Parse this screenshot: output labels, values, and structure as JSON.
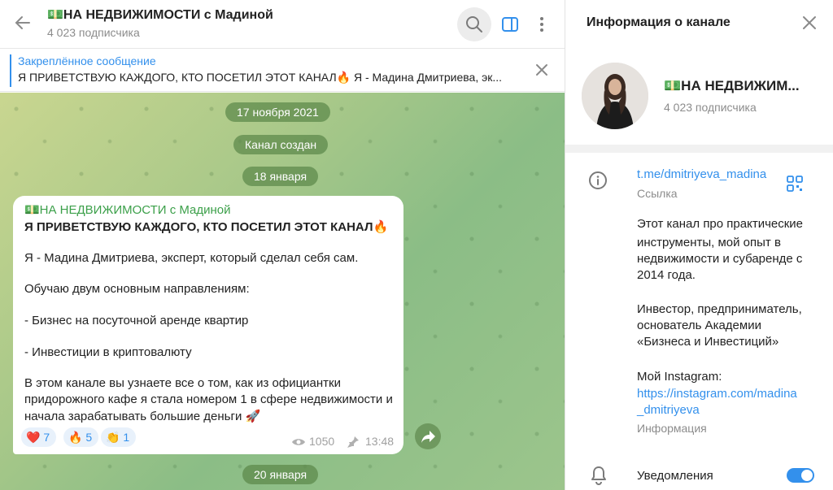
{
  "channel": {
    "title": "💵НА НЕДВИЖИМОСТИ с Мадиной",
    "subscribers": "4 023 подписчика"
  },
  "pinned": {
    "title": "Закреплённое сообщение",
    "text": "Я ПРИВЕТСТВУЮ КАЖДОГО, КТО ПОСЕТИЛ ЭТОТ КАНАЛ🔥  Я - Мадина Дмитриева, эк..."
  },
  "dates": {
    "d1": "17 ноября 2021",
    "created": "Канал создан",
    "d2": "18 января",
    "d3": "20 января"
  },
  "message": {
    "author": "💵НА НЕДВИЖИМОСТИ с Мадиной",
    "l1": "Я ПРИВЕТСТВУЮ КАЖДОГО, КТО ПОСЕТИЛ ЭТОТ КАНАЛ🔥",
    "l2": "Я - Мадина Дмитриева, эксперт, который сделал себя сам.",
    "l3": "Обучаю двум основным направлениям:",
    "l4": "- Бизнес на посуточной аренде квартир",
    "l5": "- Инвестиции в криптовалюту",
    "l6": "В этом канале вы узнаете все о том, как из официантки",
    "l7": "придорожного кафе я стала номером 1 в сфере недвижимости и",
    "l8": "начала зарабатывать большие деньги 🚀",
    "reactions": [
      {
        "emoji": "❤️",
        "count": "7"
      },
      {
        "emoji": "🔥",
        "count": "5"
      },
      {
        "emoji": "👏",
        "count": "1"
      }
    ],
    "views": "1050",
    "time": "13:48"
  },
  "info": {
    "header": "Информация о канале",
    "name": "💵НА НЕДВИЖИМ...",
    "subscribers": "4 023 подписчика",
    "link": "t.me/dmitriyeva_madina",
    "link_label": "Ссылка",
    "desc1": "Этот канал про практические",
    "desc2": "инструменты, мой опыт в",
    "desc3": "недвижимости и субаренде с",
    "desc4": "2014 года.",
    "desc5": "Инвестор, предприниматель,",
    "desc6": "основатель Академии",
    "desc7": "«Бизнеса и Инвестиций»",
    "desc8": "Мой Instagram:",
    "url1": "https://instagram.com/madina",
    "url2": "_dmitriyeva",
    "info_label": "Информация",
    "notifications": "Уведомления"
  },
  "colors": {
    "accent": "#3390ec",
    "author": "#3ca04a",
    "pill": "#5c884a"
  }
}
